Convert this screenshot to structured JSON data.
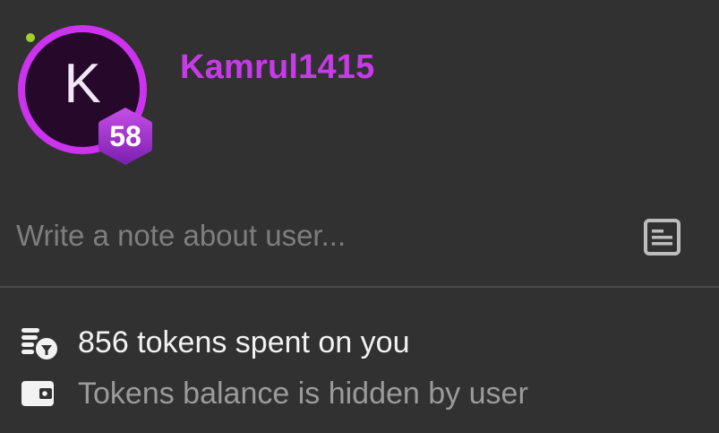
{
  "profile": {
    "avatar_initial": "K",
    "level": "58",
    "username": "Kamrul1415",
    "online": true
  },
  "note": {
    "placeholder": "Write a note about user...",
    "value": "",
    "icon": "note-icon"
  },
  "stats": {
    "tokens_spent": "856 tokens spent on you",
    "tokens_spent_icon": "coins-icon",
    "balance_text": "Tokens balance is hidden by user",
    "balance_icon": "wallet-icon"
  },
  "colors": {
    "background": "#313131",
    "username": "#c63ae8",
    "avatar_ring": "#cc33ee",
    "avatar_bg": "#26082a",
    "online": "#a4d02c",
    "badge_top": "#c84ee6",
    "badge_bottom": "#7a1fb0"
  }
}
